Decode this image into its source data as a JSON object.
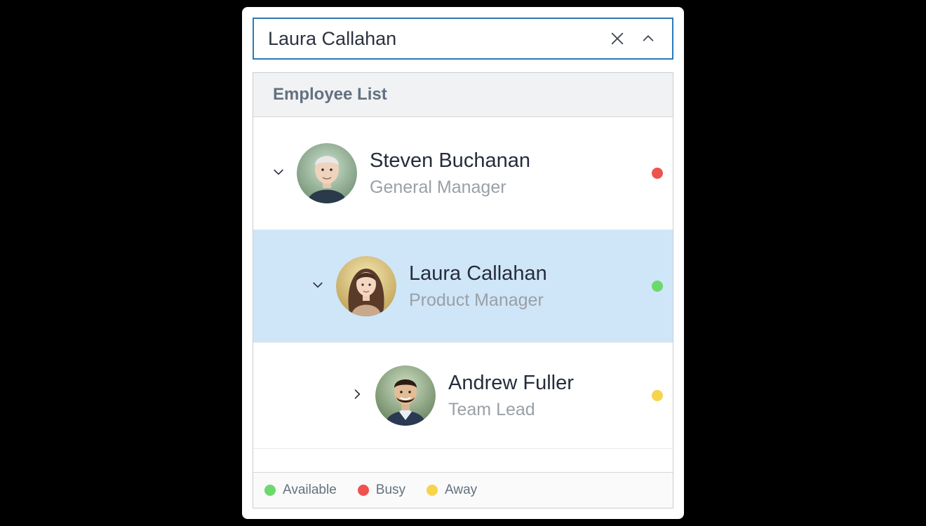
{
  "input": {
    "value": "Laura Callahan",
    "clear_icon": "close-icon",
    "toggle_icon": "chevron-up-icon"
  },
  "dropdown": {
    "header": "Employee List",
    "items": [
      {
        "name": "Steven Buchanan",
        "title": "General Manager",
        "status": "busy",
        "expanded": true,
        "depth": 0,
        "selected": false
      },
      {
        "name": "Laura Callahan",
        "title": "Product Manager",
        "status": "available",
        "expanded": true,
        "depth": 1,
        "selected": true
      },
      {
        "name": "Andrew Fuller",
        "title": "Team Lead",
        "status": "away",
        "expanded": false,
        "depth": 2,
        "selected": false
      }
    ],
    "legend": {
      "available": "Available",
      "busy": "Busy",
      "away": "Away"
    }
  },
  "colors": {
    "accent": "#2a7ab9",
    "available": "#6cd96c",
    "busy": "#ef5350",
    "away": "#f6d44b",
    "selected_bg": "#cfe6f8"
  }
}
